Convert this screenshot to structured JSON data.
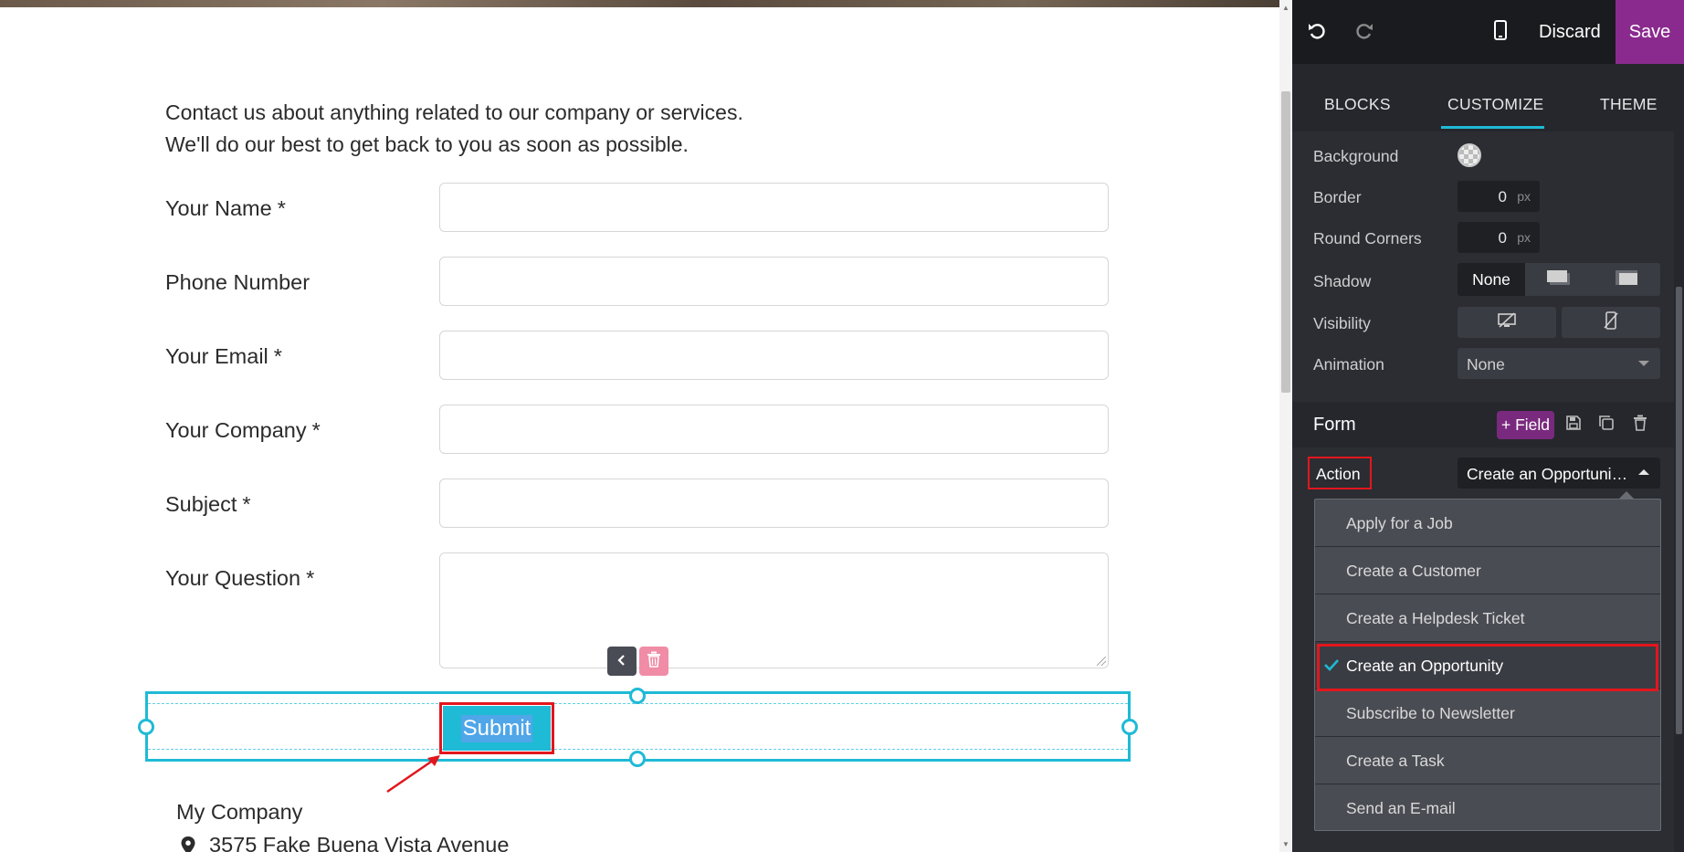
{
  "page": {
    "intro": [
      "Contact us about anything related to our company or services.",
      "We'll do our best to get back to you as soon as possible."
    ],
    "fields": [
      {
        "label": "Your Name",
        "required": "*"
      },
      {
        "label": "Phone Number",
        "required": ""
      },
      {
        "label": "Your Email",
        "required": "*"
      },
      {
        "label": "Your Company",
        "required": "*"
      },
      {
        "label": "Subject",
        "required": "*"
      },
      {
        "label": "Your Question",
        "required": "*"
      }
    ],
    "submit_label": "Submit",
    "company_name": "My Company",
    "address": "3575 Fake Buena Vista Avenue"
  },
  "editor": {
    "discard_label": "Discard",
    "save_label": "Save",
    "tabs": {
      "blocks": "BLOCKS",
      "customize": "CUSTOMIZE",
      "theme": "THEME"
    },
    "options": {
      "background_label": "Background",
      "border_label": "Border",
      "border_value": "0",
      "round_corners_label": "Round Corners",
      "round_corners_value": "0",
      "unit": "px",
      "shadow_label": "Shadow",
      "shadow_none": "None",
      "visibility_label": "Visibility",
      "animation_label": "Animation",
      "animation_value": "None"
    },
    "form_section": {
      "title": "Form",
      "add_field_label": "+ Field",
      "action_label": "Action",
      "action_value": "Create an Opportuni…"
    },
    "action_options": [
      {
        "label": "Apply for a Job",
        "selected": false
      },
      {
        "label": "Create a Customer",
        "selected": false
      },
      {
        "label": "Create a Helpdesk Ticket",
        "selected": false
      },
      {
        "label": "Create an Opportunity",
        "selected": true
      },
      {
        "label": "Subscribe to Newsletter",
        "selected": false
      },
      {
        "label": "Create a Task",
        "selected": false
      },
      {
        "label": "Send an E-mail",
        "selected": false
      }
    ]
  },
  "colors": {
    "accent": "#1fbad6",
    "brand": "#8a2a8e",
    "highlight": "#e2161d"
  }
}
